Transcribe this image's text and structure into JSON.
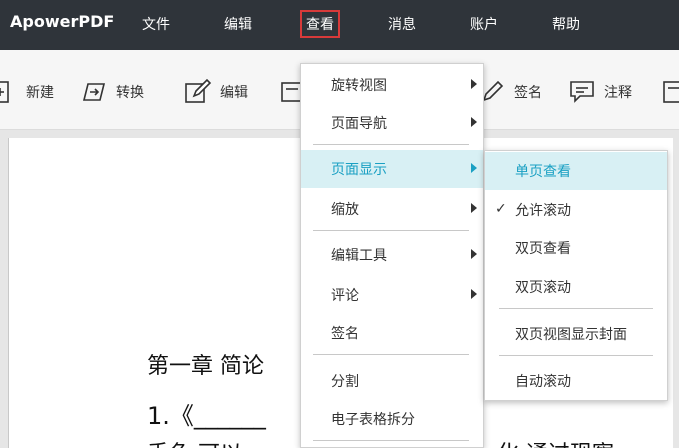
{
  "menubar": {
    "brand": "ApowerPDF",
    "items": [
      "文件",
      "编辑",
      "查看",
      "消息",
      "账户",
      "帮助"
    ],
    "active_index": 2
  },
  "toolbar": {
    "tools": [
      {
        "label": "新建",
        "icon": "new-document-icon"
      },
      {
        "label": "转换",
        "icon": "convert-icon"
      },
      {
        "label": "编辑",
        "icon": "edit-pencil-icon"
      },
      {
        "label": "签名",
        "icon": "signature-pen-icon"
      },
      {
        "label": "注释",
        "icon": "comment-icon"
      }
    ]
  },
  "view_menu": {
    "items": [
      {
        "label": "旋转视图",
        "has_submenu": true
      },
      {
        "label": "页面导航",
        "has_submenu": true
      },
      {
        "label": "页面显示",
        "has_submenu": true,
        "highlighted": true
      },
      {
        "label": "缩放",
        "has_submenu": true
      },
      {
        "label": "编辑工具",
        "has_submenu": true
      },
      {
        "label": "评论",
        "has_submenu": true
      },
      {
        "label": "签名",
        "has_submenu": false
      },
      {
        "label": "分割",
        "has_submenu": false
      },
      {
        "label": "电子表格拆分",
        "has_submenu": false
      }
    ]
  },
  "page_display_submenu": {
    "items": [
      {
        "label": "单页查看",
        "highlighted": true,
        "checked": false
      },
      {
        "label": "允许滚动",
        "highlighted": false,
        "checked": true
      },
      {
        "label": "双页查看",
        "highlighted": false,
        "checked": false
      },
      {
        "label": "双页滚动",
        "highlighted": false,
        "checked": false
      },
      {
        "label": "双页视图显示封面",
        "highlighted": false,
        "checked": false
      },
      {
        "label": "自动滚动",
        "highlighted": false,
        "checked": false
      }
    ],
    "check_mark": "✓"
  },
  "document": {
    "line1": "第一章 简论",
    "line2": "1.《______",
    "line3": "手色  可以",
    "line3_right": "化  通过现察"
  },
  "colors": {
    "menubar_bg": "#2f343a",
    "highlight_bg": "#d8f0f4",
    "highlight_text": "#1aa0c3",
    "active_outline": "#d83a3a"
  }
}
